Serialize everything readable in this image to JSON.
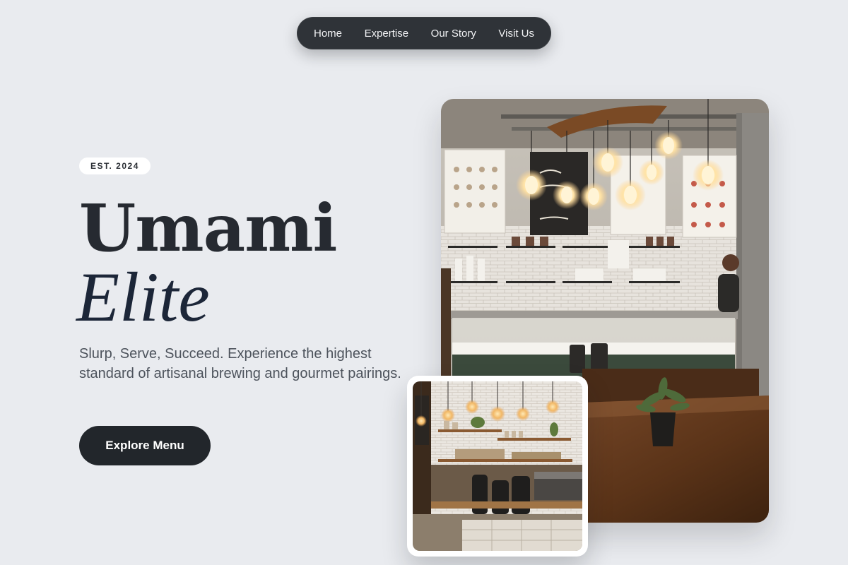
{
  "nav": {
    "items": [
      {
        "label": "Home"
      },
      {
        "label": "Expertise"
      },
      {
        "label": "Our Story"
      },
      {
        "label": "Visit Us"
      }
    ]
  },
  "hero": {
    "badge": "EST. 2024",
    "title_line1": "Umami",
    "title_line2": "Elite",
    "tagline": "Slurp, Serve, Succeed. Experience the highest standard of artisanal brewing and gourmet pairings.",
    "cta_label": "Explore Menu"
  },
  "images": {
    "main": {
      "alt": "Café interior with pendant bulbs and menu boards",
      "icon": "cafe-photo"
    },
    "secondary": {
      "alt": "Coffee bar with shelves and espresso machines",
      "icon": "coffee-bar-photo"
    }
  },
  "colors": {
    "background": "#e9ebef",
    "nav_bg": "#2f3338",
    "button_bg": "#22262b",
    "title": "#262a31",
    "title_italic": "#1c2638"
  }
}
